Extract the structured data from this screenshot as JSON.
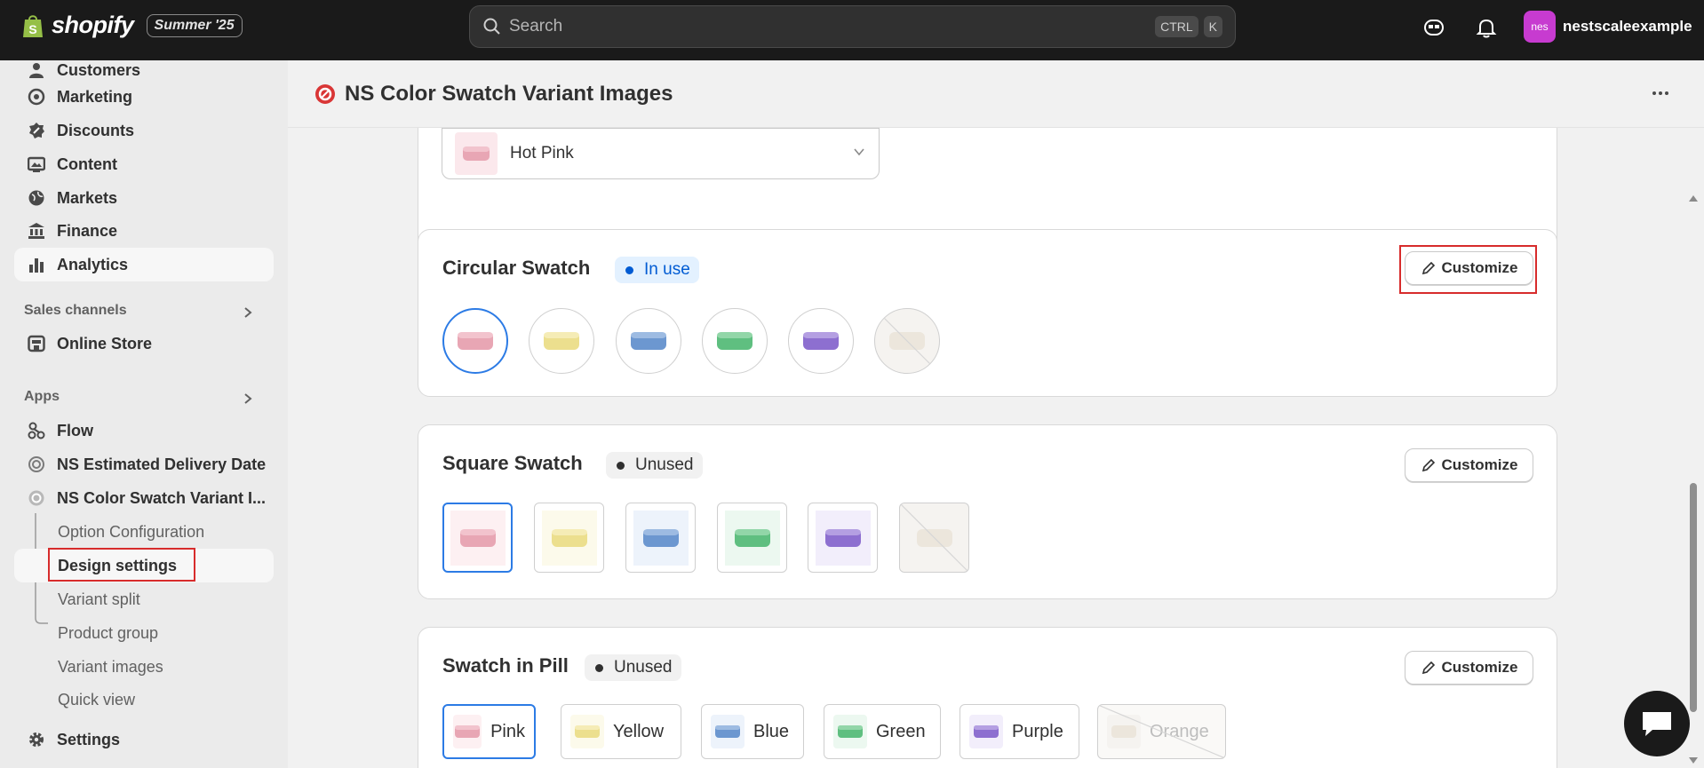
{
  "topbar": {
    "brand": "shopify",
    "edition_badge": "Summer '25",
    "search_placeholder": "Search",
    "shortcut_key1": "CTRL",
    "shortcut_key2": "K",
    "user_initials": "nes",
    "user_name": "nestscaleexample"
  },
  "sidebar": {
    "items": [
      {
        "label": "Customers",
        "icon": "person-icon"
      },
      {
        "label": "Marketing",
        "icon": "target-icon"
      },
      {
        "label": "Discounts",
        "icon": "discount-icon"
      },
      {
        "label": "Content",
        "icon": "image-icon"
      },
      {
        "label": "Markets",
        "icon": "globe-icon"
      },
      {
        "label": "Finance",
        "icon": "bank-icon"
      },
      {
        "label": "Analytics",
        "icon": "bar-chart-icon"
      }
    ],
    "sales_channels_label": "Sales channels",
    "online_store_label": "Online Store",
    "apps_label": "Apps",
    "apps": [
      {
        "label": "Flow",
        "icon": "flow-icon"
      },
      {
        "label": "NS Estimated Delivery Date",
        "icon": "app-icon"
      },
      {
        "label": "NS Color Swatch Variant I...",
        "icon": "app-icon"
      }
    ],
    "subitems": [
      "Option Configuration",
      "Design settings",
      "Variant split",
      "Product group",
      "Variant images",
      "Quick view"
    ],
    "settings_label": "Settings"
  },
  "page": {
    "title": "NS Color Swatch Variant Images"
  },
  "dropdown": {
    "value": "Hot Pink"
  },
  "swatch_colors": {
    "pink": "#e8a6b4",
    "yellow": "#ecdf8e",
    "blue": "#6c97d0",
    "green": "#5fbf80",
    "purple": "#8d6fd0",
    "orange": "#ece6dc"
  },
  "cards": {
    "circular": {
      "title": "Circular Swatch",
      "status": "In use",
      "button": "Customize"
    },
    "square": {
      "title": "Square Swatch",
      "status": "Unused",
      "button": "Customize"
    },
    "pill": {
      "title": "Swatch in Pill",
      "status": "Unused",
      "button": "Customize",
      "options": [
        "Pink",
        "Yellow",
        "Blue",
        "Green",
        "Purple",
        "Orange"
      ]
    }
  }
}
